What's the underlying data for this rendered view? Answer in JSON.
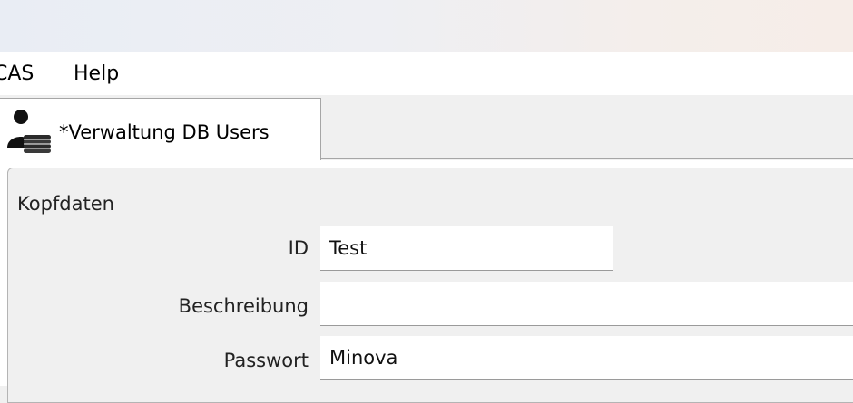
{
  "menu": {
    "items": [
      "CAS",
      "Help"
    ]
  },
  "tab": {
    "label": "*Verwaltung DB Users",
    "icon": "user-database-icon"
  },
  "group": {
    "title": "Kopfdaten"
  },
  "fields": {
    "id": {
      "label": "ID",
      "value": "Test"
    },
    "beschreibung": {
      "label": "Beschreibung",
      "value": ""
    },
    "passwort": {
      "label": "Passwort",
      "value": "Minova"
    }
  }
}
